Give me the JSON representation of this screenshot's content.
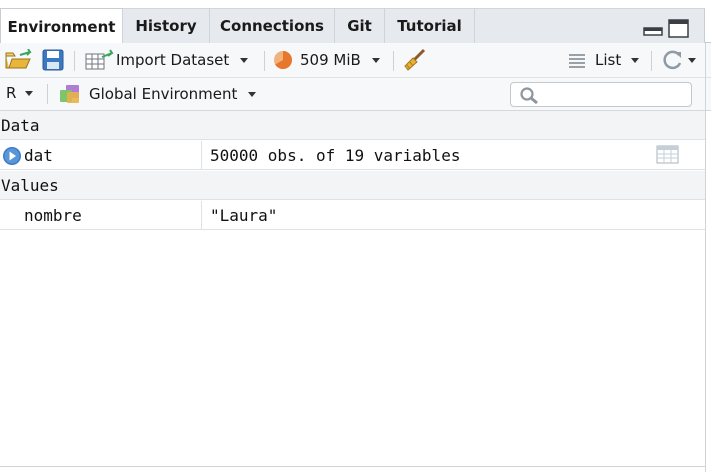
{
  "tabs": [
    {
      "label": "Environment",
      "active": true
    },
    {
      "label": "History",
      "active": false
    },
    {
      "label": "Connections",
      "active": false
    },
    {
      "label": "Git",
      "active": false
    },
    {
      "label": "Tutorial",
      "active": false
    }
  ],
  "toolbar": {
    "import_dataset_label": "Import Dataset",
    "memory_label": "509 MiB",
    "view_mode_label": "List",
    "language_label": "R",
    "environment_label": "Global Environment",
    "search_placeholder": ""
  },
  "sections": {
    "data_header": "Data",
    "values_header": "Values"
  },
  "data_rows": [
    {
      "name": "dat",
      "value": "50000 obs. of 19 variables"
    }
  ],
  "value_rows": [
    {
      "name": "nombre",
      "value": "\"Laura\""
    }
  ],
  "colors": {
    "accent_blue": "#3d7cc9",
    "memory_orange": "#e8772e",
    "folder_yellow": "#e9b63b",
    "save_blue": "#3b78c2"
  },
  "icons": [
    "open-folder-icon",
    "save-icon",
    "import-dataset-icon",
    "memory-pie-icon",
    "broom-icon",
    "list-icon",
    "refresh-icon",
    "environment-cubes-icon",
    "search-icon",
    "expand-arrow-icon",
    "data-viewer-icon",
    "minimize-icon",
    "maximize-icon"
  ]
}
